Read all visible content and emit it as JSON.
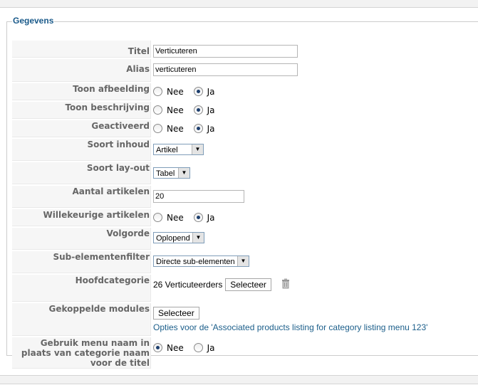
{
  "legend": "Gegevens",
  "fields": {
    "titel": {
      "label": "Titel",
      "value": "Verticuteren"
    },
    "alias": {
      "label": "Alias",
      "value": "verticuteren"
    },
    "toon_afbeelding": {
      "label": "Toon afbeelding",
      "no": "Nee",
      "yes": "Ja",
      "selected": "Ja"
    },
    "toon_beschrijving": {
      "label": "Toon beschrijving",
      "no": "Nee",
      "yes": "Ja",
      "selected": "Ja"
    },
    "geactiveerd": {
      "label": "Geactiveerd",
      "no": "Nee",
      "yes": "Ja",
      "selected": "Ja"
    },
    "soort_inhoud": {
      "label": "Soort inhoud",
      "value": "Artikel"
    },
    "soort_layout": {
      "label": "Soort lay-out",
      "value": "Tabel"
    },
    "aantal_artikelen": {
      "label": "Aantal artikelen",
      "value": "20"
    },
    "willekeurige": {
      "label": "Willekeurige artikelen",
      "no": "Nee",
      "yes": "Ja",
      "selected": "Ja"
    },
    "volgorde": {
      "label": "Volgorde",
      "value": "Oplopend"
    },
    "subfilter": {
      "label": "Sub-elementenfilter",
      "value": "Directe sub-elementen"
    },
    "hoofdcategorie": {
      "label": "Hoofdcategorie",
      "value": "26 Verticuteerders",
      "button": "Selecteer"
    },
    "modules": {
      "label": "Gekoppelde modules",
      "button": "Selecteer",
      "link": "Opties voor de 'Associated products listing for category listing menu 123'"
    },
    "menu_naam": {
      "label": "Gebruik menu naam in plaats van categorie naam voor de titel",
      "no": "Nee",
      "yes": "Ja",
      "selected": "Nee"
    }
  }
}
